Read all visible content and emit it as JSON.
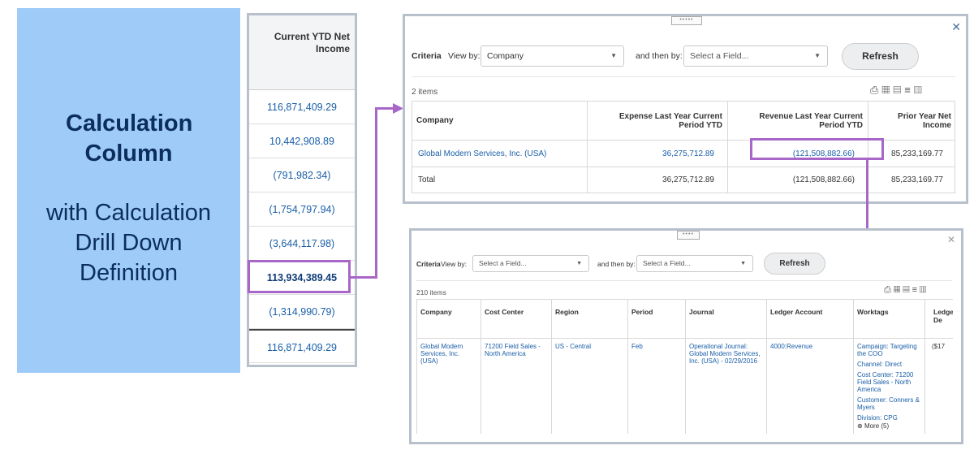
{
  "callout": {
    "title": "Calculation Column",
    "subtitle": "with Calculation Drill Down Definition"
  },
  "column_report": {
    "header": "Current YTD Net Income",
    "values": [
      "116,871,409.29",
      "10,442,908.89",
      "(791,982.34)",
      "(1,754,797.94)",
      "(3,644,117.98)",
      "113,934,389.45",
      "(1,314,990.79)"
    ],
    "total": "116,871,409.29",
    "highlighted_value": "113,934,389.45"
  },
  "drill1": {
    "criteria_label": "Criteria",
    "view_by_label": "View by:",
    "view_by_value": "Company",
    "then_by_label": "and then by:",
    "then_by_placeholder": "Select a Field...",
    "refresh_label": "Refresh",
    "item_count": "2 items",
    "columns": [
      "Company",
      "Expense Last Year Current Period YTD",
      "Revenue Last Year Current Period YTD",
      "Prior Year Net Income"
    ],
    "rows": [
      [
        "Global Modern Services, Inc. (USA)",
        "36,275,712.89",
        "(121,508,882.66)",
        "85,233,169.77"
      ],
      [
        "Total",
        "36,275,712.89",
        "(121,508,882.66)",
        "85,233,169.77"
      ]
    ]
  },
  "drill2": {
    "criteria_label": "Criteria",
    "view_by_label": "View by:",
    "view_by_placeholder": "Select a Field...",
    "then_by_label": "and then by:",
    "then_by_placeholder": "Select a Field...",
    "refresh_label": "Refresh",
    "item_count": "210 items",
    "columns": [
      "Company",
      "Cost Center",
      "Region",
      "Period",
      "Journal",
      "Ledger Account",
      "Worktags",
      "Ledge De"
    ],
    "row": {
      "company": "Global Modern Services, Inc. (USA)",
      "cost_center": "71200 Field Sales - North America",
      "region": "US - Central",
      "period": "Feb",
      "journal": "Operational Journal: Global Modern Services, Inc. (USA) - 02/29/2016",
      "ledger_account": "4000:Revenue",
      "worktags": [
        "Campaign: Targeting the COO",
        "Channel: Direct",
        "Cost Center: 71200 Field Sales - North America",
        "Customer: Conners & Myers",
        "Division: CPG"
      ],
      "more": "More (5)",
      "ledger_debit": "($17"
    }
  },
  "colors": {
    "panel_bg": "#9ecbf7",
    "panel_text": "#0c2e5c",
    "highlight": "#a866c8",
    "link": "#1a5fa8"
  }
}
